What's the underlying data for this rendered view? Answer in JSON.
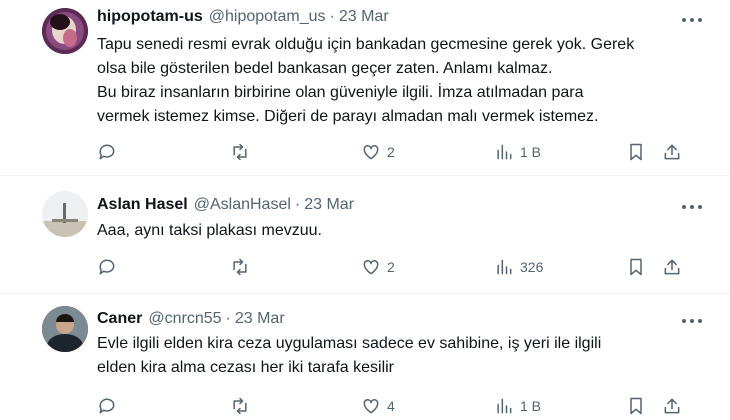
{
  "tweets": [
    {
      "name": "hipopotam-us",
      "handle": "@hipopotam_us",
      "separator": "·",
      "time": "23 Mar",
      "lines": [
        "Tapu senedi resmi evrak olduğu için bankadan gecmesine gerek yok. Gerek",
        "olsa bile gösterilen bedel bankasan geçer zaten. Anlamı kalmaz.",
        "Bu biraz insanların birbirine olan güveniyle ilgili. İmza atılmadan para",
        "vermek istemez kimse. Diğeri de parayı almadan malı vermek istemez."
      ],
      "replies": "",
      "retweets": "",
      "likes": "2",
      "views": "1 B"
    },
    {
      "name": "Aslan Hasel",
      "handle": "@AslanHasel",
      "separator": "·",
      "time": "23 Mar",
      "lines": [
        "Aaa, aynı taksi plakası mevzuu."
      ],
      "replies": "",
      "retweets": "",
      "likes": "2",
      "views": "326"
    },
    {
      "name": "Caner",
      "handle": "@cnrcn55",
      "separator": "·",
      "time": "23 Mar",
      "lines": [
        "Evle ilgili elden kira ceza uygulaması sadece ev sahibine, iş yeri ile ilgili",
        "elden kira alma cezası her iki tarafa kesilir"
      ],
      "replies": "",
      "retweets": "",
      "likes": "4",
      "views": "1 B"
    }
  ],
  "icons": {
    "reply": "reply-icon",
    "retweet": "retweet-icon",
    "like": "heart-icon",
    "views": "views-icon",
    "bookmark": "bookmark-icon",
    "share": "share-icon",
    "more": "more-icon"
  },
  "colors": {
    "text": "#0f1419",
    "secondary": "#536471",
    "divider": "#eff3f4"
  }
}
